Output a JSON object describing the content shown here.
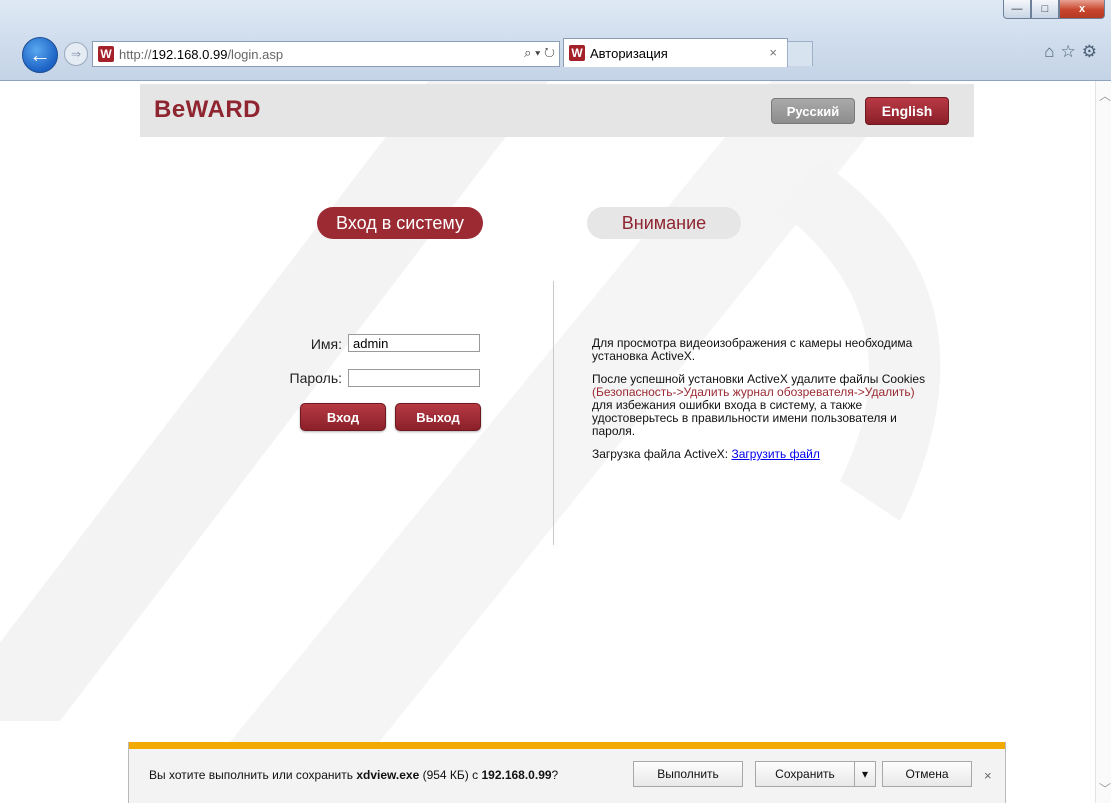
{
  "browser": {
    "address": {
      "protocol": "http://",
      "host": "192.168.0.99",
      "path": "/login.asp",
      "tools": "⌕ ▾ ↻"
    },
    "tab": {
      "title": "Авторизация",
      "close": "×"
    },
    "favicon_glyph": "W",
    "window_controls": {
      "minimize": "—",
      "maximize": "□",
      "close": "x"
    },
    "nav": {
      "back": "←",
      "forward": "⇒"
    },
    "right_tools": "⌂☆⚙"
  },
  "page": {
    "logo": "BeWARD",
    "lang_buttons": {
      "ru": "Русский",
      "en": "English"
    },
    "tabs": {
      "login": "Вход в систему",
      "notice": "Внимание"
    },
    "form": {
      "username_label": "Имя:",
      "username_value": "admin",
      "password_label": "Пароль:",
      "password_value": "",
      "login_button": "Вход",
      "exit_button": "Выход"
    },
    "notice": {
      "p1": "Для просмотра видеоизображения с камеры необходима установка ActiveX.",
      "p2_before": "После успешной установки ActiveX удалите файлы Cookies ",
      "p2_highlight": "(Безопасность->Удалить журнал обозревателя->Удалить)",
      "p2_after": " для избежания ошибки входа в систему, а также удостоверьтесь в правильности имени пользователя и пароля.",
      "p3_label": "Загрузка файла ActiveX: ",
      "p3_link": "Загрузить файл"
    }
  },
  "download_bar": {
    "prompt_prefix": "Вы хотите выполнить или сохранить ",
    "file_name": "xdview.exe",
    "file_size": " (954 КБ) с ",
    "source": "192.168.0.99",
    "prompt_suffix": "?",
    "run_button": "Выполнить",
    "save_button": "Сохранить",
    "save_dropdown": "▾",
    "cancel_button": "Отмена",
    "close": "×"
  },
  "scrollbar": {
    "up": "︿",
    "down": "﹀"
  },
  "colors": {
    "brand": "#9b2a33",
    "accent_bar": "#f2a900",
    "link": "#0000ee"
  }
}
